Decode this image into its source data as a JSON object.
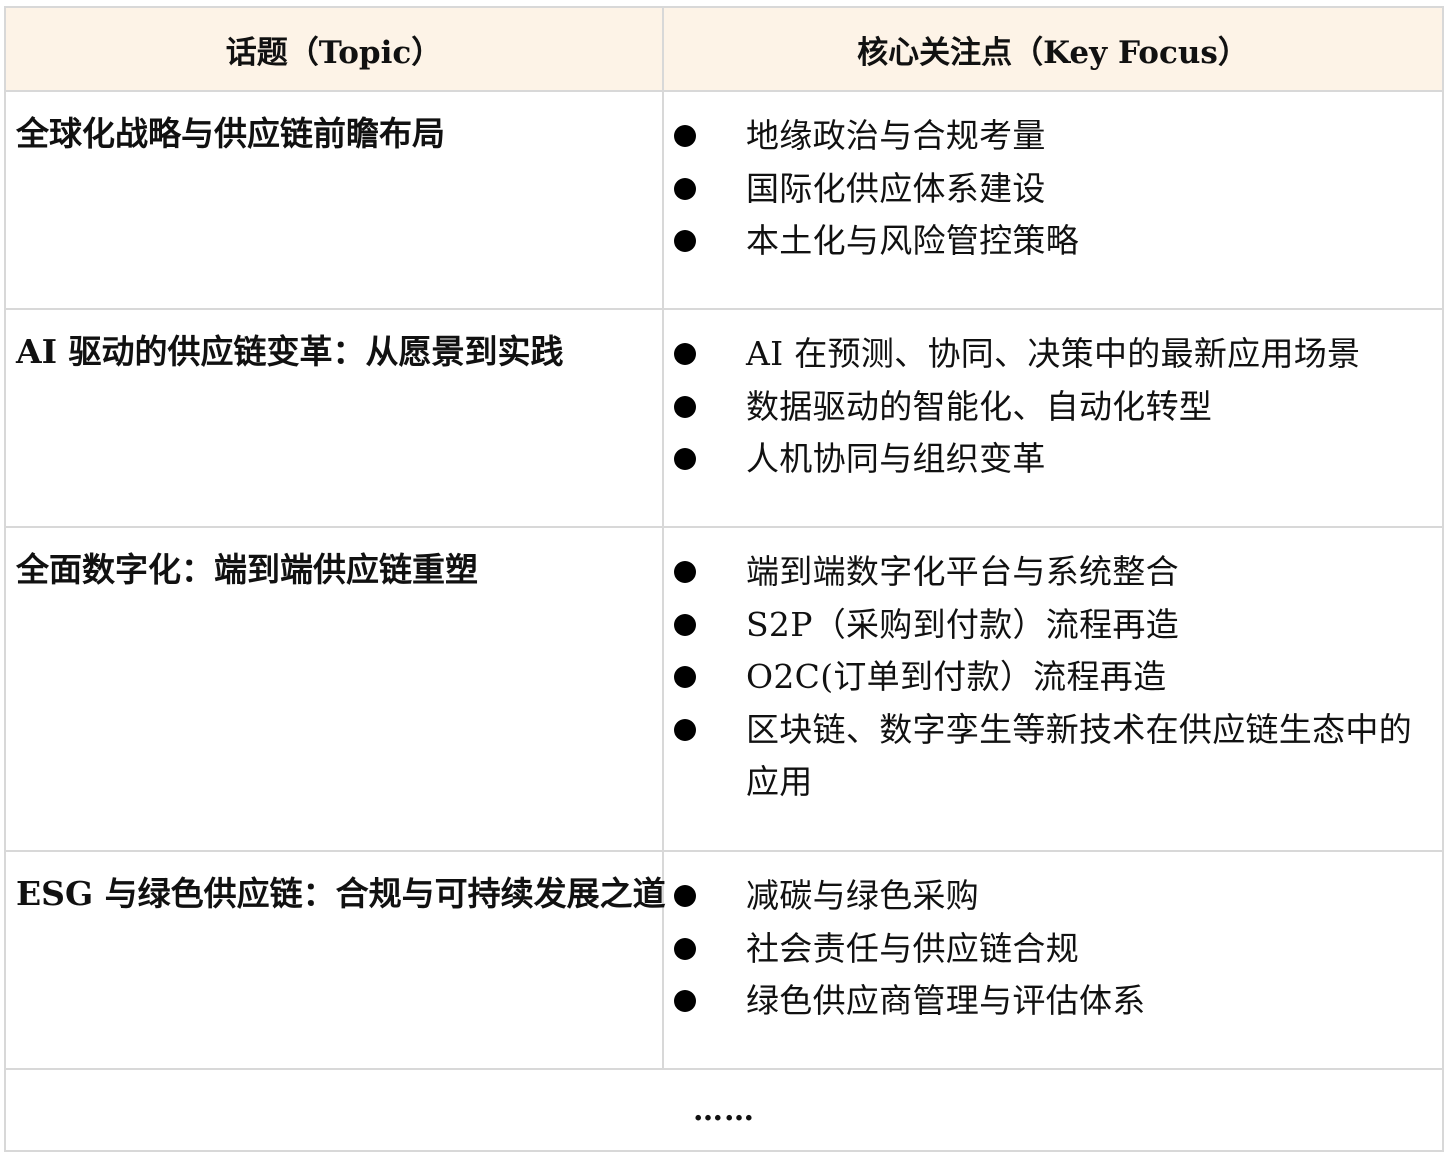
{
  "table": {
    "header": {
      "topic": "话题（Topic）",
      "focus": "核心关注点（Key Focus）"
    },
    "rows": [
      {
        "topic": "全球化战略与供应链前瞻布局",
        "focus": [
          "地缘政治与合规考量",
          "国际化供应体系建设",
          "本土化与风险管控策略"
        ]
      },
      {
        "topic": "AI 驱动的供应链变革：从愿景到实践",
        "focus": [
          "AI 在预测、协同、决策中的最新应用场景",
          "数据驱动的智能化、自动化转型",
          "人机协同与组织变革"
        ]
      },
      {
        "topic": "全面数字化：端到端供应链重塑",
        "focus": [
          "端到端数字化平台与系统整合",
          "S2P（采购到付款）流程再造",
          "O2C(订单到付款）流程再造",
          "区块链、数字孪生等新技术在供应链生态中的应用"
        ]
      },
      {
        "topic": "ESG 与绿色供应链：合规与可持续发展之道",
        "focus": [
          "减碳与绿色采购",
          "社会责任与供应链合规",
          "绿色供应商管理与评估体系"
        ]
      }
    ],
    "footer": "……"
  }
}
